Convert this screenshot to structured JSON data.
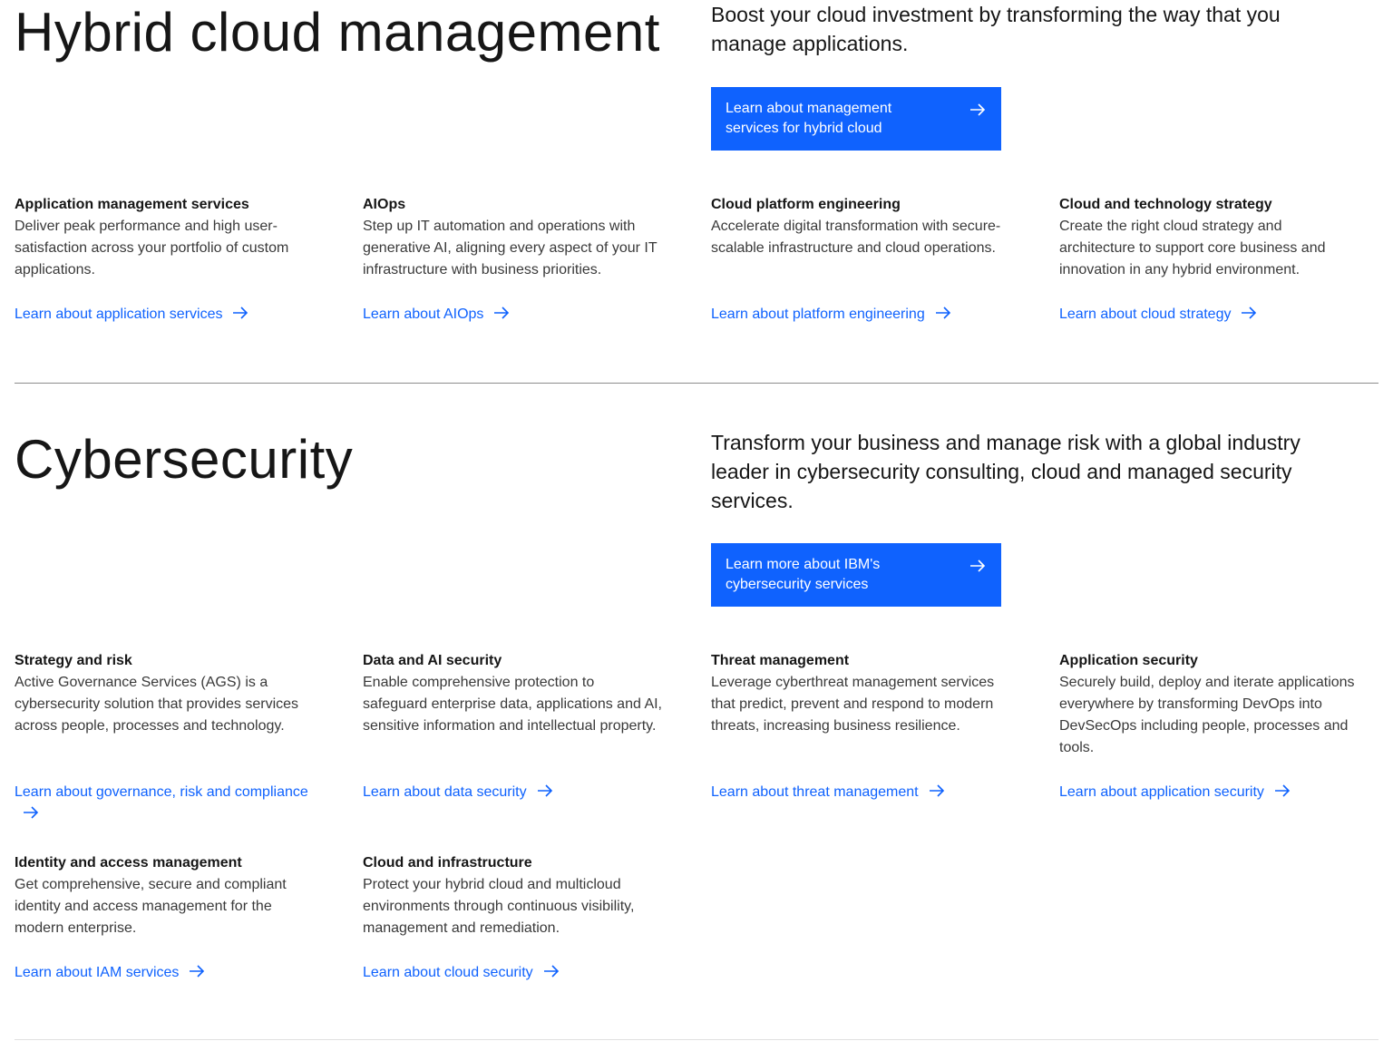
{
  "hybrid": {
    "title": "Hybrid cloud management",
    "lead": "Boost your cloud investment by transforming the way that you manage applications.",
    "cta": {
      "line1": "Learn about management",
      "line2": "services for hybrid cloud",
      "icon": "arrow-right-icon"
    },
    "cards": [
      {
        "title": "Application management services",
        "desc": "Deliver peak performance and high user-satisfaction across your portfolio of custom applications.",
        "link": "Learn about application services"
      },
      {
        "title": "AIOps",
        "desc": "Step up IT automation and operations with generative AI, aligning every aspect of your IT infrastructure with business priorities.",
        "link": "Learn about AIOps"
      },
      {
        "title": "Cloud platform engineering",
        "desc": "Accelerate digital transformation with secure-scalable infrastructure and cloud operations.",
        "link": "Learn about platform engineering"
      },
      {
        "title": "Cloud and technology strategy",
        "desc": "Create the right cloud strategy and architecture to support core business and innovation in any hybrid environment.",
        "link": "Learn about cloud strategy"
      }
    ]
  },
  "cyber": {
    "title": "Cybersecurity",
    "lead": "Transform your business and manage risk with a global industry leader in cybersecurity consulting, cloud and managed security services.",
    "cta": {
      "line1": "Learn more about IBM's",
      "line2": "cybersecurity services",
      "icon": "arrow-right-icon"
    },
    "cards": [
      {
        "title": "Strategy and risk",
        "desc": "Active Governance Services (AGS) is a cybersecurity solution that provides services across people, processes and technology.",
        "link": "Learn about governance, risk and compliance"
      },
      {
        "title": "Data and AI security",
        "desc": "Enable comprehensive protection to safeguard enterprise data, applications and AI, sensitive information and intellectual property.",
        "link": "Learn about data security"
      },
      {
        "title": "Threat management",
        "desc": "Leverage cyberthreat management services that predict, prevent and respond to modern threats, increasing business resilience.",
        "link": "Learn about threat management"
      },
      {
        "title": "Application security",
        "desc": "Securely build, deploy and iterate applications everywhere by transforming DevOps into DevSecOps including people, processes and tools.",
        "link": "Learn about application security"
      },
      {
        "title": "Identity and access management",
        "desc": "Get comprehensive, secure and compliant identity and access management for the modern enterprise.",
        "link": "Learn about IAM services"
      },
      {
        "title": "Cloud and infrastructure",
        "desc": "Protect your hybrid cloud and multicloud environments through continuous visibility, management and remediation.",
        "link": "Learn about cloud security"
      }
    ]
  },
  "colors": {
    "accent": "#0f62fe",
    "text": "#161616",
    "body_text": "#393939",
    "divider": "#8d8d8d"
  }
}
